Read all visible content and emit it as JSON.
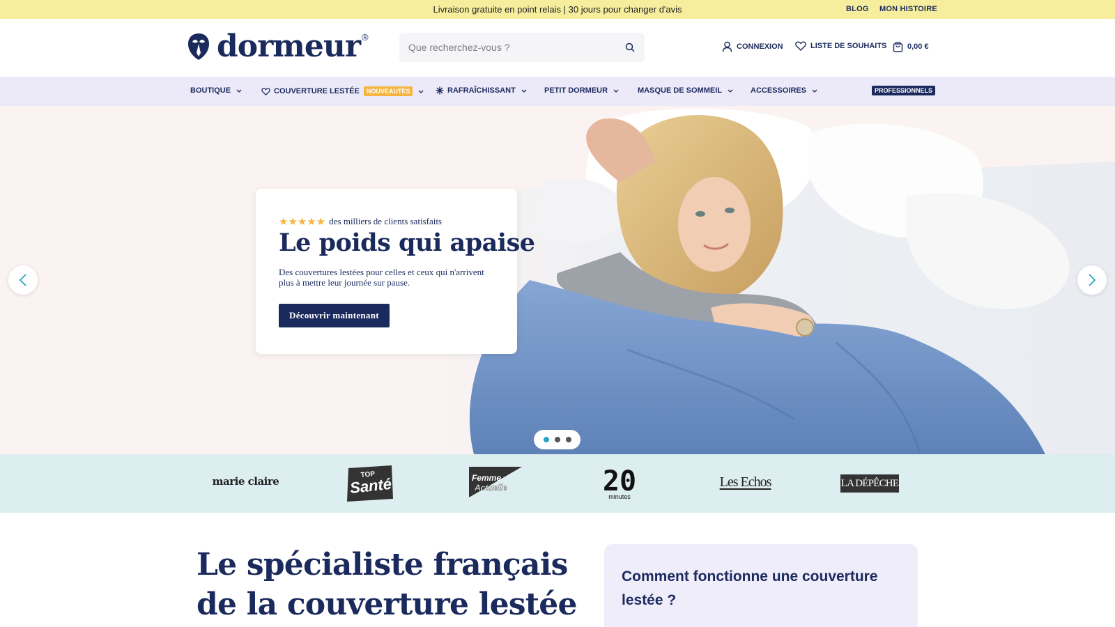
{
  "topbar": {
    "promo": "Livraison gratuite en point relais | 30 jours pour changer d'avis",
    "links": [
      "BLOG",
      "MON HISTOIRE"
    ]
  },
  "header": {
    "brand": "dormeur",
    "trademark": "®",
    "search_placeholder": "Que recherchez-vous ?",
    "login": "CONNEXION",
    "wishlist": "LISTE DE SOUHAITS",
    "cart_total": "0,00 €"
  },
  "nav": {
    "items": [
      {
        "label": "BOUTIQUE"
      },
      {
        "label": "COUVERTURE LESTÉE",
        "badge": "NOUVEAUTÉS"
      },
      {
        "label": "RAFRAÎCHISSANT"
      },
      {
        "label": "PETIT DORMEUR"
      },
      {
        "label": "MASQUE DE SOMMEIL"
      },
      {
        "label": "ACCESSOIRES"
      }
    ],
    "pro_badge": "PROFESSIONNELS"
  },
  "hero": {
    "stars": "★★★★★",
    "rating_count": 5,
    "rating_text": "des milliers de clients satisfaits",
    "title": "Le poids qui apaise",
    "subtitle": "Des couvertures lestées pour celles et ceux qui n'arrivent plus à mettre leur journée sur pause.",
    "cta": "Découvrir maintenant",
    "slides": 3,
    "active_slide": 1
  },
  "press": {
    "logos": [
      "marie claire",
      "TOP Santé",
      "Femme Actuelle",
      "20 minutes",
      "Les Echos",
      "LA DÉPÊCHE"
    ]
  },
  "intro": {
    "title_line1": "Le spécialiste français",
    "title_line2": "de la couverture lestée"
  },
  "faq": {
    "title": "Comment fonctionne une couverture lestée ?"
  },
  "colors": {
    "navy": "#1b2a5c",
    "topbar_yellow": "#f6ee9d",
    "nav_lavender": "#eceaf9",
    "badge_orange": "#f5b540",
    "press_band": "#ddeef0",
    "accent_teal": "#2aa3c0"
  }
}
